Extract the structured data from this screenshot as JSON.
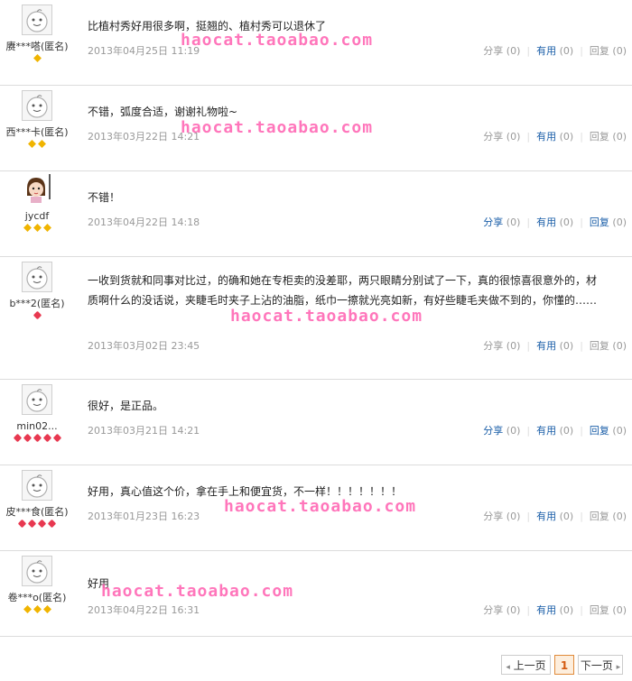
{
  "reviews": [
    {
      "user": "赓***嗒(匿名)",
      "badge": "gold",
      "badge_count": 1,
      "avatar": "default",
      "content": "比植村秀好用很多啊，挺翘的、植村秀可以退休了",
      "date": "2013年04月25日 11:19",
      "share": "分享",
      "share_count": "(0)",
      "useful": "有用",
      "useful_count": "(0)",
      "reply": "回复",
      "reply_count": "(0)",
      "hl": false
    },
    {
      "user": "西***卡(匿名)",
      "badge": "gold",
      "badge_count": 2,
      "avatar": "default",
      "content": "不错，弧度合适，谢谢礼物啦~",
      "date": "2013年03月22日 14:21",
      "share": "分享",
      "share_count": "(0)",
      "useful": "有用",
      "useful_count": "(0)",
      "reply": "回复",
      "reply_count": "(0)",
      "hl": false
    },
    {
      "user": "jycdf",
      "badge": "gold",
      "badge_count": 3,
      "avatar": "photo",
      "content": "不错！",
      "date": "2013年04月22日 14:18",
      "share": "分享",
      "share_count": "(0)",
      "useful": "有用",
      "useful_count": "(0)",
      "reply": "回复",
      "reply_count": "(0)",
      "hl": true
    },
    {
      "user": "b***2(匿名)",
      "badge": "heart",
      "badge_count": 1,
      "avatar": "default",
      "content": "一收到货就和同事对比过，的确和她在专柜卖的没差耶，两只眼睛分别试了一下，真的很惊喜很意外的，材质啊什么的没话说，夹睫毛时夹子上沾的油脂，纸巾一擦就光亮如新，有好些睫毛夹做不到的，你懂的……",
      "date": "2013年03月02日 23:45",
      "share": "分享",
      "share_count": "(0)",
      "useful": "有用",
      "useful_count": "(0)",
      "reply": "回复",
      "reply_count": "(0)",
      "hl": false
    },
    {
      "user": "min02...",
      "badge": "heart",
      "badge_count": 5,
      "avatar": "default",
      "content": "很好，是正品。",
      "date": "2013年03月21日 14:21",
      "share": "分享",
      "share_count": "(0)",
      "useful": "有用",
      "useful_count": "(0)",
      "reply": "回复",
      "reply_count": "(0)",
      "hl": true
    },
    {
      "user": "皮***食(匿名)",
      "badge": "heart",
      "badge_count": 4,
      "avatar": "default",
      "content": "好用，真心值这个价，拿在手上和便宜货，不一样！！！！！！！",
      "date": "2013年01月23日 16:23",
      "share": "分享",
      "share_count": "(0)",
      "useful": "有用",
      "useful_count": "(0)",
      "reply": "回复",
      "reply_count": "(0)",
      "hl": false
    },
    {
      "user": "卷***o(匿名)",
      "badge": "gold",
      "badge_count": 3,
      "avatar": "default",
      "content": "好用",
      "date": "2013年04月22日 16:31",
      "share": "分享",
      "share_count": "(0)",
      "useful": "有用",
      "useful_count": "(0)",
      "reply": "回复",
      "reply_count": "(0)",
      "hl": false
    }
  ],
  "watermark": "haocat.taoabao.com",
  "pager": {
    "prev": "上一页",
    "current": "1",
    "next": "下一页"
  },
  "colors": {
    "link": "#1a5ea8",
    "watermark": "#ff5fb0",
    "muted": "#999999",
    "gold_badge": "#f0b400",
    "heart_badge": "#e83850"
  }
}
